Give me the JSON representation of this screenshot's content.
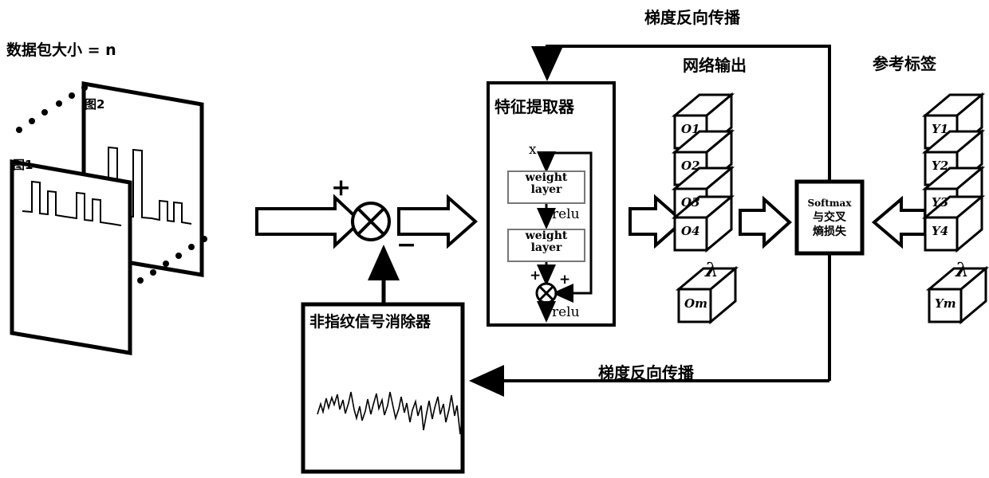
{
  "diagram": {
    "title_packet": "数据包大小 = n",
    "input_cards": [
      {
        "label": "图1"
      },
      {
        "label": "图2"
      }
    ],
    "sum_node": {
      "symbol": "⊗",
      "plus_sign": "+",
      "minus_sign": "−"
    },
    "feature_extractor": {
      "title": "特征提取器",
      "input_var": "x",
      "blocks": [
        {
          "line1": "weight",
          "line2": "layer"
        },
        {
          "line1": "weight",
          "line2": "layer"
        }
      ],
      "relu_mid": "relu",
      "relu_out": "relu",
      "merge_symbol": "⊗",
      "merge_plus_left": "+",
      "merge_plus_right": "+"
    },
    "denoiser": {
      "title": "非指纹信号消除器"
    },
    "network_output": {
      "header": "网络输出",
      "items": [
        "O1",
        "O2",
        "O3",
        "O4"
      ],
      "ellipsis_symbol": "λ",
      "last_item": "Om"
    },
    "reference_labels": {
      "header": "参考标签",
      "items": [
        "Y1",
        "Y2",
        "Y3",
        "Y4"
      ],
      "ellipsis_symbol": "λ",
      "last_item": "Ym"
    },
    "loss_block": {
      "line1": "Softmax",
      "line2": "与交叉",
      "line3": "熵损失"
    },
    "backprop_top_label": "梯度反向传播",
    "backprop_bottom_label": "梯度反向传播",
    "colors": {
      "stroke": "#000000",
      "fill": "#ffffff",
      "inner_stroke": "#555555"
    }
  }
}
